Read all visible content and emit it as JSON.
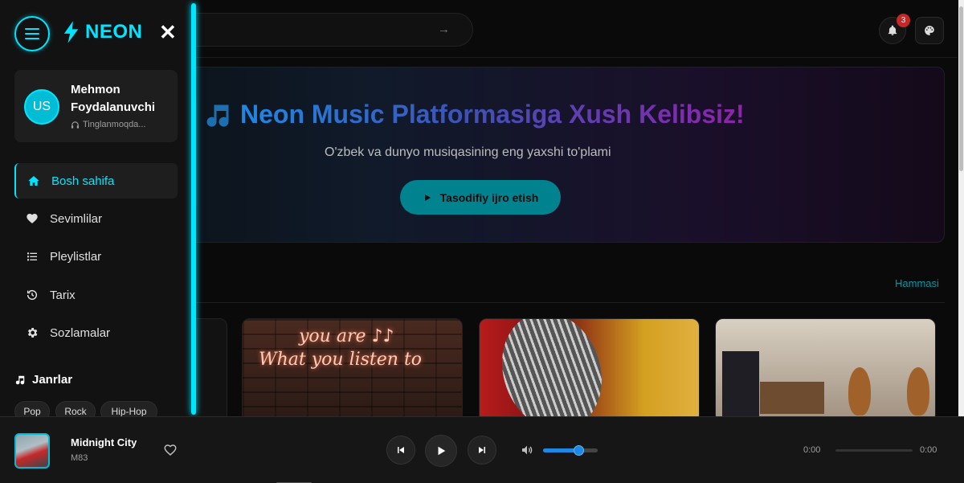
{
  "app": {
    "logo": "NEON"
  },
  "header": {
    "notification_count": "3"
  },
  "user": {
    "initials": "US",
    "name": "Mehmon Foydalanuvchi",
    "status": "Tinglanmoqda..."
  },
  "sidebar": {
    "items": [
      {
        "label": "Bosh sahifa",
        "icon": "home-icon",
        "active": true
      },
      {
        "label": "Sevimlilar",
        "icon": "heart-icon",
        "active": false
      },
      {
        "label": "Pleylistlar",
        "icon": "list-icon",
        "active": false
      },
      {
        "label": "Tarix",
        "icon": "history-icon",
        "active": false
      },
      {
        "label": "Sozlamalar",
        "icon": "gear-icon",
        "active": false
      }
    ],
    "genres_title": "Janrlar",
    "genres": [
      "Pop",
      "Rock",
      "Hip-Hop"
    ]
  },
  "hero": {
    "title": "Neon Music Platformasiga Xush Kelibsiz!",
    "subtitle": "O'zbek va dunyo musiqasining eng yaxshi to'plami",
    "button": "Tasodifiy ijro etish"
  },
  "section": {
    "see_all": "Hammasi"
  },
  "cards": {
    "neon_text_line1": "you are ♪♪",
    "neon_text_line2": "What you listen to"
  },
  "player": {
    "title": "Midnight City",
    "artist": "M83",
    "current_time": "0:00",
    "duration": "0:00",
    "volume": 0.65,
    "progress": 0
  },
  "colors": {
    "accent": "#00e5ff",
    "teal_button": "#00838f",
    "badge": "#c62828",
    "volume": "#1e88e5"
  }
}
